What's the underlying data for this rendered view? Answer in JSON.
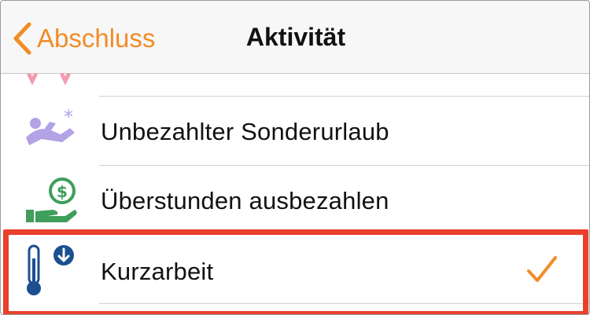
{
  "navbar": {
    "back_label": "Abschluss",
    "title": "Aktivität"
  },
  "rows": [
    {
      "label": "",
      "icon": "partial-pink-icon"
    },
    {
      "label": "Unbezahlter Sonderurlaub",
      "icon": "person-relaxing-icon"
    },
    {
      "label": "Überstunden ausbezahlen",
      "icon": "hand-money-icon"
    },
    {
      "label": "Kurzarbeit",
      "icon": "thermometer-down-icon",
      "selected": true
    }
  ],
  "colors": {
    "accent": "#f28c28",
    "highlight": "#e8402c",
    "purple": "#b3a2e6",
    "green": "#3f9e5a",
    "navy": "#1b4f8f"
  }
}
